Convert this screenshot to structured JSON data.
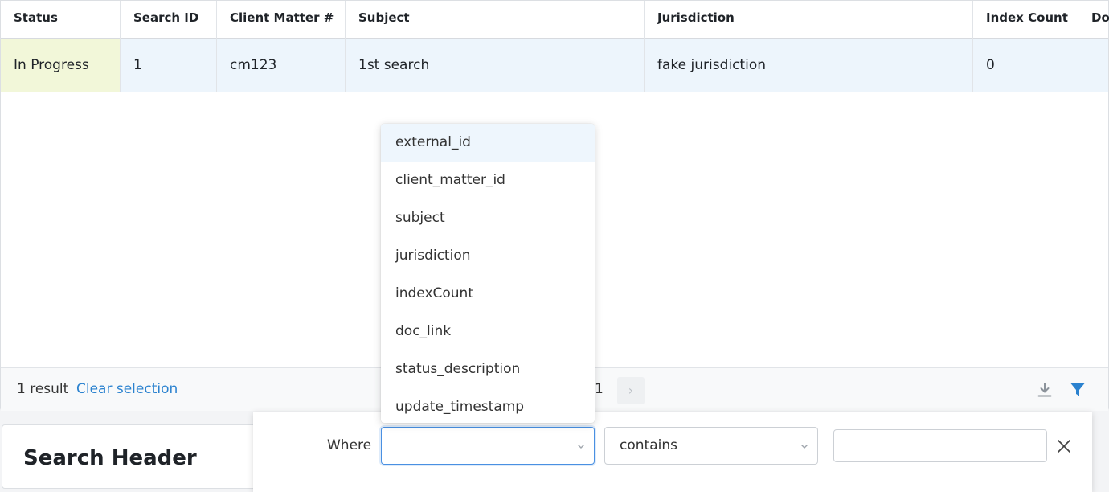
{
  "table": {
    "columns": [
      "Status",
      "Search ID",
      "Client Matter #",
      "Subject",
      "Jurisdiction",
      "Index Count",
      "Do"
    ],
    "rows": [
      [
        "In Progress",
        "1",
        "cm123",
        "1st search",
        "fake jurisdiction",
        "0",
        ""
      ]
    ]
  },
  "footer": {
    "result_count": "1 result",
    "clear_selection": "Clear selection",
    "page": "1",
    "next": "›"
  },
  "dropdown": {
    "options": [
      "external_id",
      "client_matter_id",
      "subject",
      "jurisdiction",
      "indexCount",
      "doc_link",
      "status_description",
      "update_timestamp"
    ],
    "highlighted_index": 0
  },
  "filter": {
    "where_label": "Where",
    "field_value": "",
    "operator_value": "contains",
    "value_input": ""
  },
  "lower_card": {
    "title": "Search Header"
  },
  "icons": {
    "download": "download-icon",
    "filter": "filter-icon",
    "close": "close-icon",
    "chevron": "chevron-down-icon"
  },
  "colors": {
    "accent": "#2b82cf",
    "row_bg": "#edf5fc",
    "status_bg": "#f2f7d9",
    "dropdown_highlight": "#eef6fd"
  }
}
